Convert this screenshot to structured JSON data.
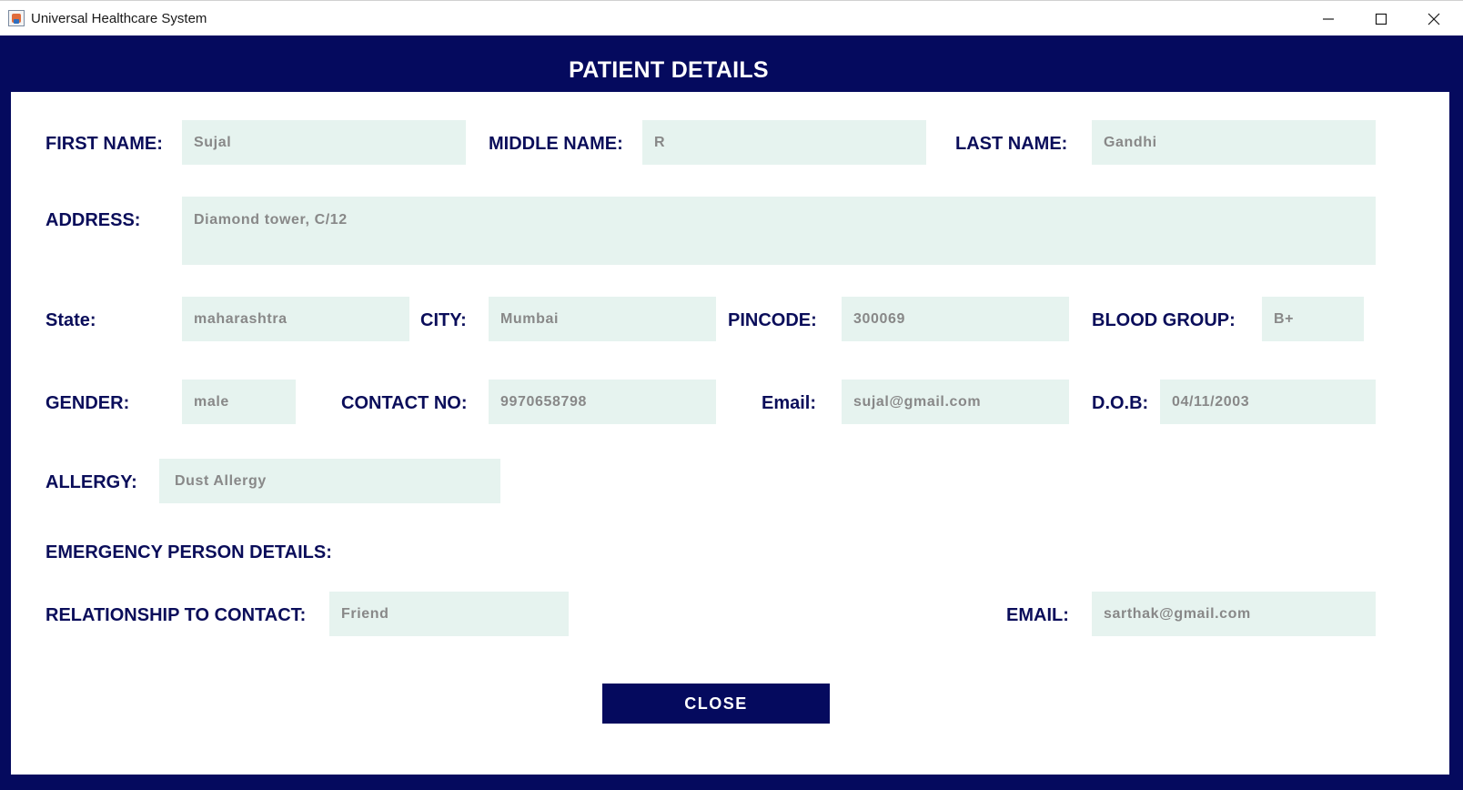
{
  "window": {
    "title": "Universal Healthcare System",
    "icon": "java-app-icon"
  },
  "header": {
    "title": "PATIENT DETAILS"
  },
  "form": {
    "first_name": {
      "label": "FIRST NAME:",
      "value": "Sujal"
    },
    "middle_name": {
      "label": "MIDDLE NAME:",
      "value": "R"
    },
    "last_name": {
      "label": "LAST NAME:",
      "value": "Gandhi"
    },
    "address": {
      "label": "ADDRESS:",
      "value": "Diamond tower, C/12"
    },
    "state": {
      "label": "State:",
      "value": "maharashtra"
    },
    "city": {
      "label": "CITY:",
      "value": "Mumbai"
    },
    "pincode": {
      "label": "PINCODE:",
      "value": "300069"
    },
    "blood_group": {
      "label": "BLOOD GROUP:",
      "value": "B+"
    },
    "gender": {
      "label": "GENDER:",
      "value": "male"
    },
    "contact_no": {
      "label": "CONTACT NO:",
      "value": "9970658798"
    },
    "email": {
      "label": "Email:",
      "value": "sujal@gmail.com"
    },
    "dob": {
      "label": "D.O.B:",
      "value": "04/11/2003"
    },
    "allergy": {
      "label": "ALLERGY:",
      "value": "Dust Allergy"
    }
  },
  "emergency": {
    "heading": "EMERGENCY PERSON DETAILS:",
    "relationship": {
      "label": "RELATIONSHIP TO CONTACT:",
      "value": "Friend"
    },
    "email": {
      "label": "EMAIL:",
      "value": "sarthak@gmail.com"
    }
  },
  "actions": {
    "close_label": "CLOSE"
  },
  "colors": {
    "navy": "#050a5e",
    "field_bg": "#e6f3ef",
    "field_text": "#888888",
    "label_text": "#0a0d5a"
  }
}
